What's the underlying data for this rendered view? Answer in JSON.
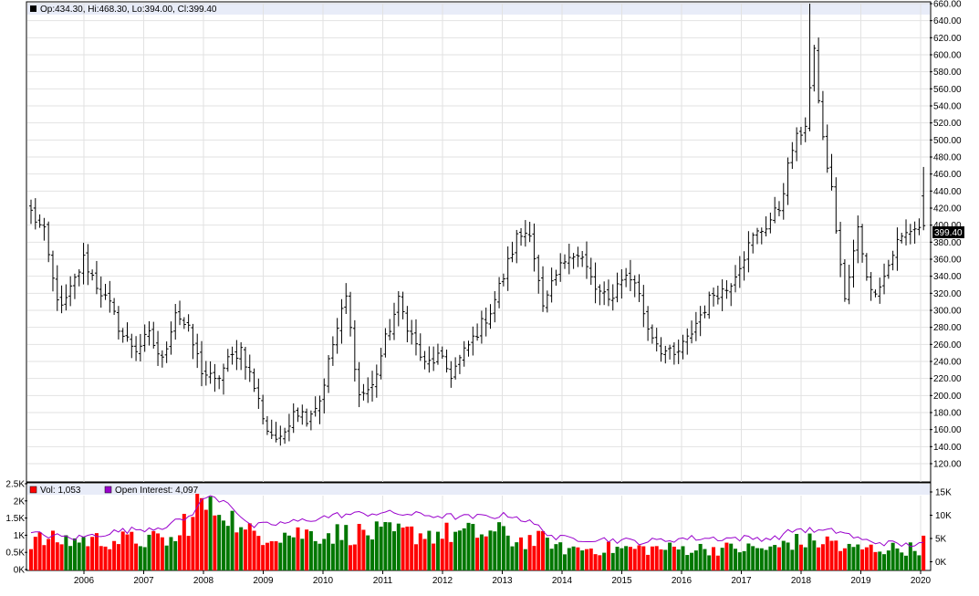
{
  "header": {
    "ohlc_text": "Op:434.30, Hi:468.30, Lo:394.00, Cl:399.40",
    "last_price_label": "399.40"
  },
  "volume_panel": {
    "vol_text": "Vol: 1,053",
    "oi_text": "Open Interest: 4,097",
    "left_ticks": [
      "2.5K",
      "2K",
      "1.5K",
      "1K",
      "0.5K",
      "0K"
    ],
    "right_ticks": [
      "15K",
      "10K",
      "5K",
      "0K"
    ]
  },
  "colors": {
    "up": "#007700",
    "down": "#ff0000",
    "oi_line": "#9900cc",
    "bar": "#000000",
    "header_band": "#e8ecf8"
  },
  "chart_data": [
    {
      "type": "ohlc",
      "yaxis_side": "right",
      "ylim": [
        120,
        660
      ],
      "y_ticks": [
        "660.00",
        "640.00",
        "620.00",
        "600.00",
        "580.00",
        "560.00",
        "540.00",
        "520.00",
        "500.00",
        "480.00",
        "460.00",
        "440.00",
        "420.00",
        "400.00",
        "380.00",
        "360.00",
        "340.00",
        "320.00",
        "300.00",
        "280.00",
        "260.00",
        "240.00",
        "220.00",
        "200.00",
        "180.00",
        "160.00",
        "140.00",
        "120.00"
      ],
      "x_labels": [
        "2006",
        "2007",
        "2008",
        "2009",
        "2010",
        "2011",
        "2012",
        "2013",
        "2014",
        "2015",
        "2016",
        "2017",
        "2018",
        "2019",
        "2020"
      ],
      "anchors": [
        [
          0,
          415
        ],
        [
          3,
          390
        ],
        [
          5,
          335
        ],
        [
          7,
          300
        ],
        [
          10,
          335
        ],
        [
          12,
          360
        ],
        [
          15,
          330
        ],
        [
          18,
          305
        ],
        [
          21,
          270
        ],
        [
          24,
          255
        ],
        [
          27,
          270
        ],
        [
          30,
          240
        ],
        [
          33,
          300
        ],
        [
          36,
          275
        ],
        [
          39,
          230
        ],
        [
          42,
          215
        ],
        [
          45,
          240
        ],
        [
          48,
          255
        ],
        [
          51,
          210
        ],
        [
          54,
          160
        ],
        [
          57,
          145
        ],
        [
          60,
          185
        ],
        [
          63,
          175
        ],
        [
          66,
          195
        ],
        [
          69,
          260
        ],
        [
          72,
          315
        ],
        [
          75,
          200
        ],
        [
          78,
          210
        ],
        [
          81,
          265
        ],
        [
          84,
          310
        ],
        [
          87,
          270
        ],
        [
          90,
          235
        ],
        [
          93,
          245
        ],
        [
          96,
          225
        ],
        [
          99,
          250
        ],
        [
          102,
          275
        ],
        [
          105,
          300
        ],
        [
          108,
          340
        ],
        [
          111,
          385
        ],
        [
          114,
          395
        ],
        [
          117,
          300
        ],
        [
          120,
          340
        ],
        [
          123,
          370
        ],
        [
          126,
          360
        ],
        [
          129,
          325
        ],
        [
          132,
          310
        ],
        [
          135,
          340
        ],
        [
          138,
          335
        ],
        [
          141,
          280
        ],
        [
          144,
          255
        ],
        [
          147,
          245
        ],
        [
          150,
          265
        ],
        [
          153,
          295
        ],
        [
          156,
          320
        ],
        [
          159,
          325
        ],
        [
          162,
          355
        ],
        [
          165,
          385
        ],
        [
          168,
          400
        ],
        [
          171,
          420
        ],
        [
          174,
          490
        ],
        [
          177,
          520
        ],
        [
          178,
          560
        ],
        [
          179,
          600
        ],
        [
          181,
          500
        ],
        [
          183,
          440
        ],
        [
          186,
          310
        ],
        [
          189,
          395
        ],
        [
          192,
          320
        ],
        [
          195,
          340
        ],
        [
          198,
          380
        ],
        [
          201,
          395
        ],
        [
          204,
          400
        ]
      ],
      "last": {
        "open": 434.3,
        "high": 468.3,
        "low": 394.0,
        "close": 399.4
      }
    },
    {
      "type": "bar",
      "series": [
        {
          "name": "Vol",
          "yaxis": "left",
          "ylim": [
            0,
            2500
          ],
          "approx_range": [
            200,
            2300
          ]
        },
        {
          "name": "Open Interest",
          "yaxis": "right",
          "type": "line",
          "ylim": [
            0,
            16000
          ],
          "anchors": [
            [
              0,
              6000
            ],
            [
              10,
              5000
            ],
            [
              20,
              6500
            ],
            [
              30,
              7500
            ],
            [
              36,
              9500
            ],
            [
              40,
              14000
            ],
            [
              45,
              13000
            ],
            [
              50,
              7500
            ],
            [
              60,
              8500
            ],
            [
              70,
              10000
            ],
            [
              80,
              10500
            ],
            [
              90,
              10000
            ],
            [
              100,
              9500
            ],
            [
              110,
              10000
            ],
            [
              115,
              8000
            ],
            [
              120,
              5000
            ],
            [
              130,
              4800
            ],
            [
              140,
              4200
            ],
            [
              150,
              5000
            ],
            [
              160,
              5000
            ],
            [
              170,
              5000
            ],
            [
              175,
              7000
            ],
            [
              180,
              6500
            ],
            [
              185,
              6500
            ],
            [
              190,
              4500
            ],
            [
              200,
              3500
            ],
            [
              204,
              4097
            ]
          ]
        }
      ],
      "last_vol": 1053,
      "last_oi": 4097
    }
  ]
}
